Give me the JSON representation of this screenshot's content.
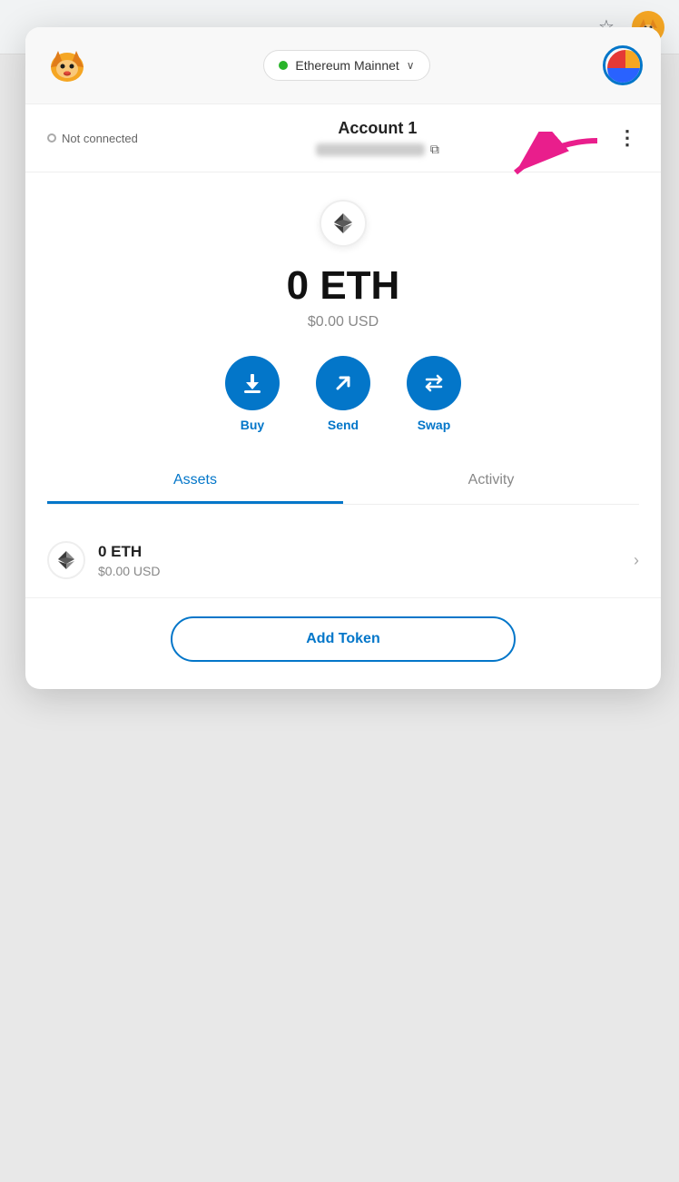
{
  "browser": {
    "star_icon": "☆",
    "fox_icon": "🦊"
  },
  "header": {
    "network_label": "Ethereum Mainnet",
    "network_dot_color": "#29b42a",
    "chevron": "∨"
  },
  "account": {
    "connection_status": "Not connected",
    "name": "Account 1",
    "address_placeholder": "0x••••••••••••",
    "more_options": "⋮"
  },
  "balance": {
    "eth": "0 ETH",
    "usd": "$0.00 USD"
  },
  "actions": [
    {
      "id": "buy",
      "label": "Buy",
      "icon": "↓"
    },
    {
      "id": "send",
      "label": "Send",
      "icon": "↗"
    },
    {
      "id": "swap",
      "label": "Swap",
      "icon": "⇄"
    }
  ],
  "tabs": [
    {
      "id": "assets",
      "label": "Assets",
      "active": true
    },
    {
      "id": "activity",
      "label": "Activity",
      "active": false
    }
  ],
  "assets": [
    {
      "symbol": "ETH",
      "balance": "0 ETH",
      "usd": "$0.00 USD"
    }
  ],
  "add_token_label": "Add Token"
}
